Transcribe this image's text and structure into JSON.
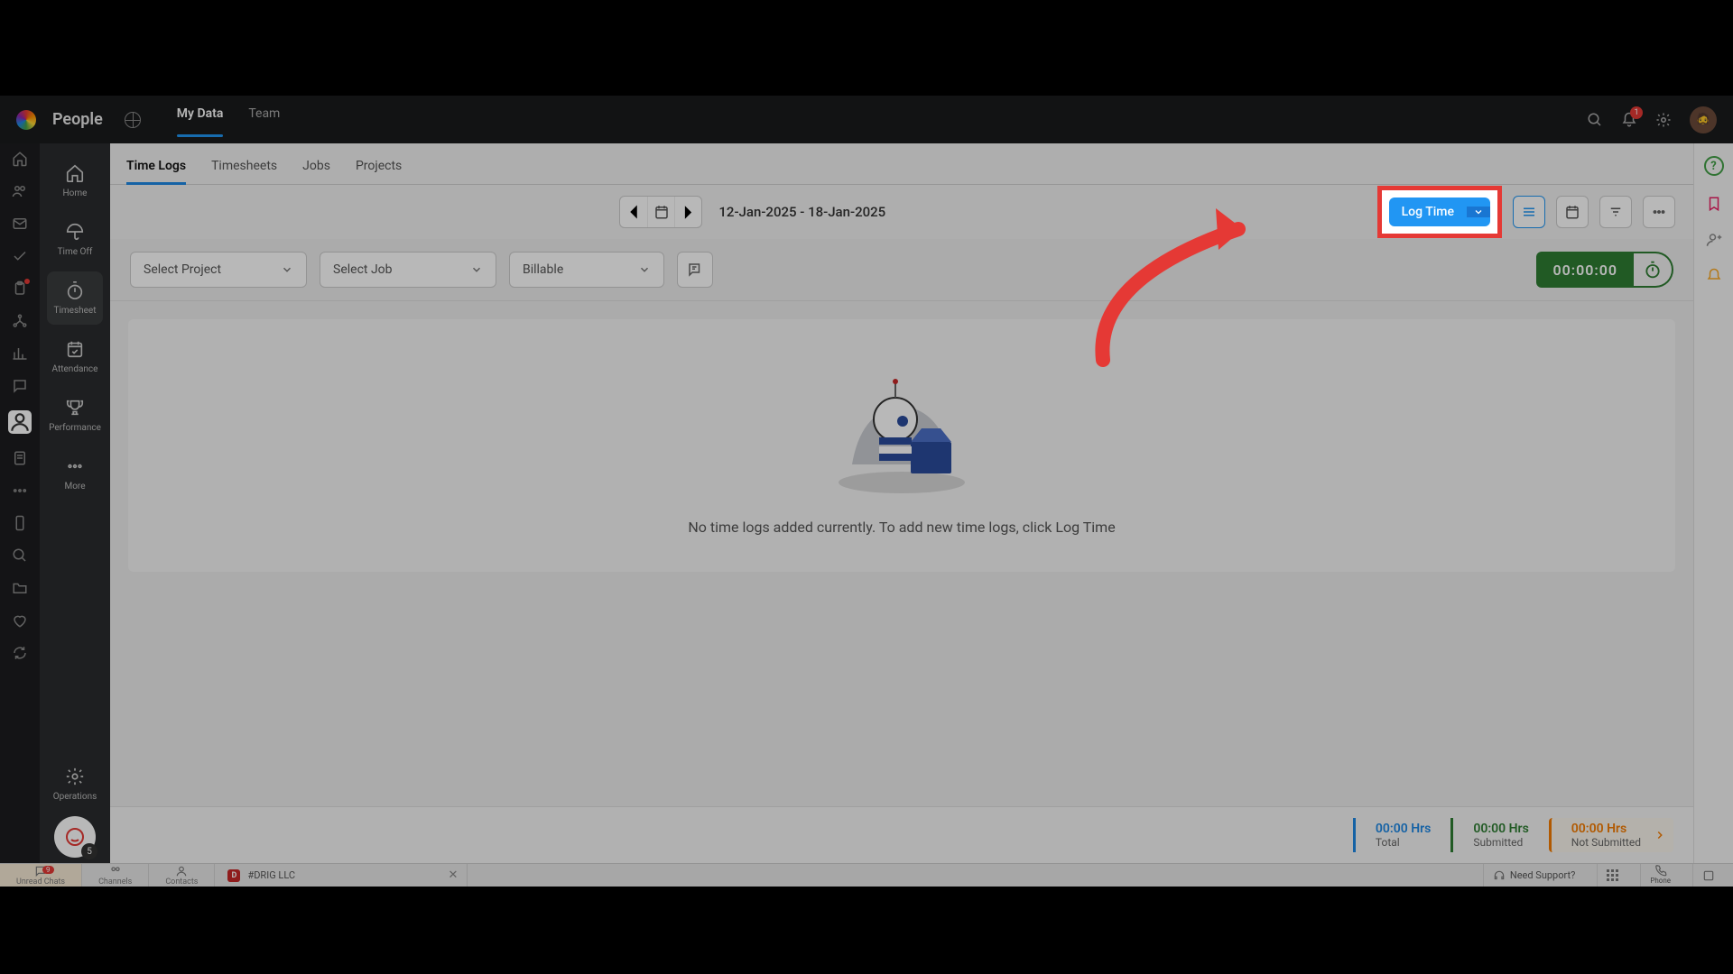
{
  "header": {
    "app_title": "People",
    "tabs": {
      "my_data": "My Data",
      "team": "Team"
    },
    "notification_count": "1"
  },
  "sidebar": {
    "items": [
      {
        "label": "Home"
      },
      {
        "label": "Time Off"
      },
      {
        "label": "Timesheet"
      },
      {
        "label": "Attendance"
      },
      {
        "label": "Performance"
      },
      {
        "label": "More"
      },
      {
        "label": "Operations"
      }
    ],
    "chat_count": "5"
  },
  "content_tabs": {
    "time_logs": "Time Logs",
    "timesheets": "Timesheets",
    "jobs": "Jobs",
    "projects": "Projects"
  },
  "toolbar": {
    "date_range": "12-Jan-2025 - 18-Jan-2025",
    "log_time_label": "Log Time"
  },
  "filters": {
    "project_placeholder": "Select Project",
    "job_placeholder": "Select Job",
    "billable_placeholder": "Billable",
    "timer_value": "00:00:00"
  },
  "empty_state": {
    "message": "No time logs added currently. To add new time logs, click Log Time"
  },
  "summary": {
    "total": {
      "value": "00:00 Hrs",
      "label": "Total"
    },
    "submitted": {
      "value": "00:00 Hrs",
      "label": "Submitted"
    },
    "not_submitted": {
      "value": "00:00 Hrs",
      "label": "Not Submitted"
    }
  },
  "bottom_bar": {
    "unread_label": "Unread Chats",
    "unread_count": "9",
    "channels_label": "Channels",
    "contacts_label": "Contacts",
    "tab_title": "#DRIG LLC",
    "support_label": "Need Support?",
    "phone_label": "Phone"
  },
  "right_rail_help_tooltip": "?"
}
